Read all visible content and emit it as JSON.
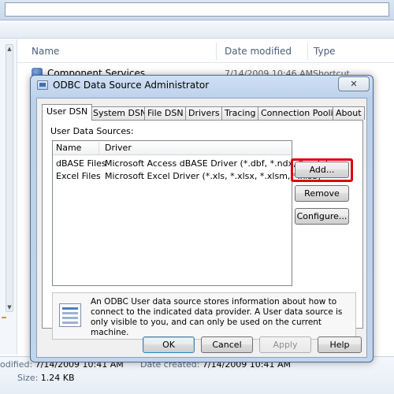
{
  "explorer": {
    "columns": {
      "name": "Name",
      "date_modified": "Date modified",
      "type": "Type"
    },
    "row": {
      "name": "Component Services",
      "date": "7/14/2009 10:46 AM",
      "type": "Shortcut"
    },
    "details": {
      "modified_label": "odified:",
      "modified_value": "7/14/2009 10:41 AM",
      "created_label": "Date created:",
      "created_value": "7/14/2009 10:41 AM",
      "size_label": "Size:",
      "size_value": "1.24 KB"
    }
  },
  "dialog": {
    "title": "ODBC Data Source Administrator",
    "close_glyph": "✕",
    "tabs": [
      {
        "label": "User DSN",
        "active": true
      },
      {
        "label": "System DSN"
      },
      {
        "label": "File DSN"
      },
      {
        "label": "Drivers"
      },
      {
        "label": "Tracing"
      },
      {
        "label": "Connection Pooling"
      },
      {
        "label": "About"
      }
    ],
    "sources_label": "User Data Sources:",
    "list": {
      "headers": {
        "name": "Name",
        "driver": "Driver"
      },
      "rows": [
        {
          "name": "dBASE Files",
          "driver": "Microsoft Access dBASE Driver (*.dbf, *.ndx, *.mdx)"
        },
        {
          "name": "Excel Files",
          "driver": "Microsoft Excel Driver (*.xls, *.xlsx, *.xlsm, *.xlsb)"
        }
      ]
    },
    "side_buttons": {
      "add": "Add...",
      "remove": "Remove",
      "configure": "Configure..."
    },
    "info_text": "An ODBC User data source stores information about how to connect to the indicated data provider.   A User data source is only visible to you, and can only be used on the current machine.",
    "footer_buttons": {
      "ok": "OK",
      "cancel": "Cancel",
      "apply": "Apply",
      "help": "Help"
    },
    "highlight_color": "#e0000e"
  }
}
